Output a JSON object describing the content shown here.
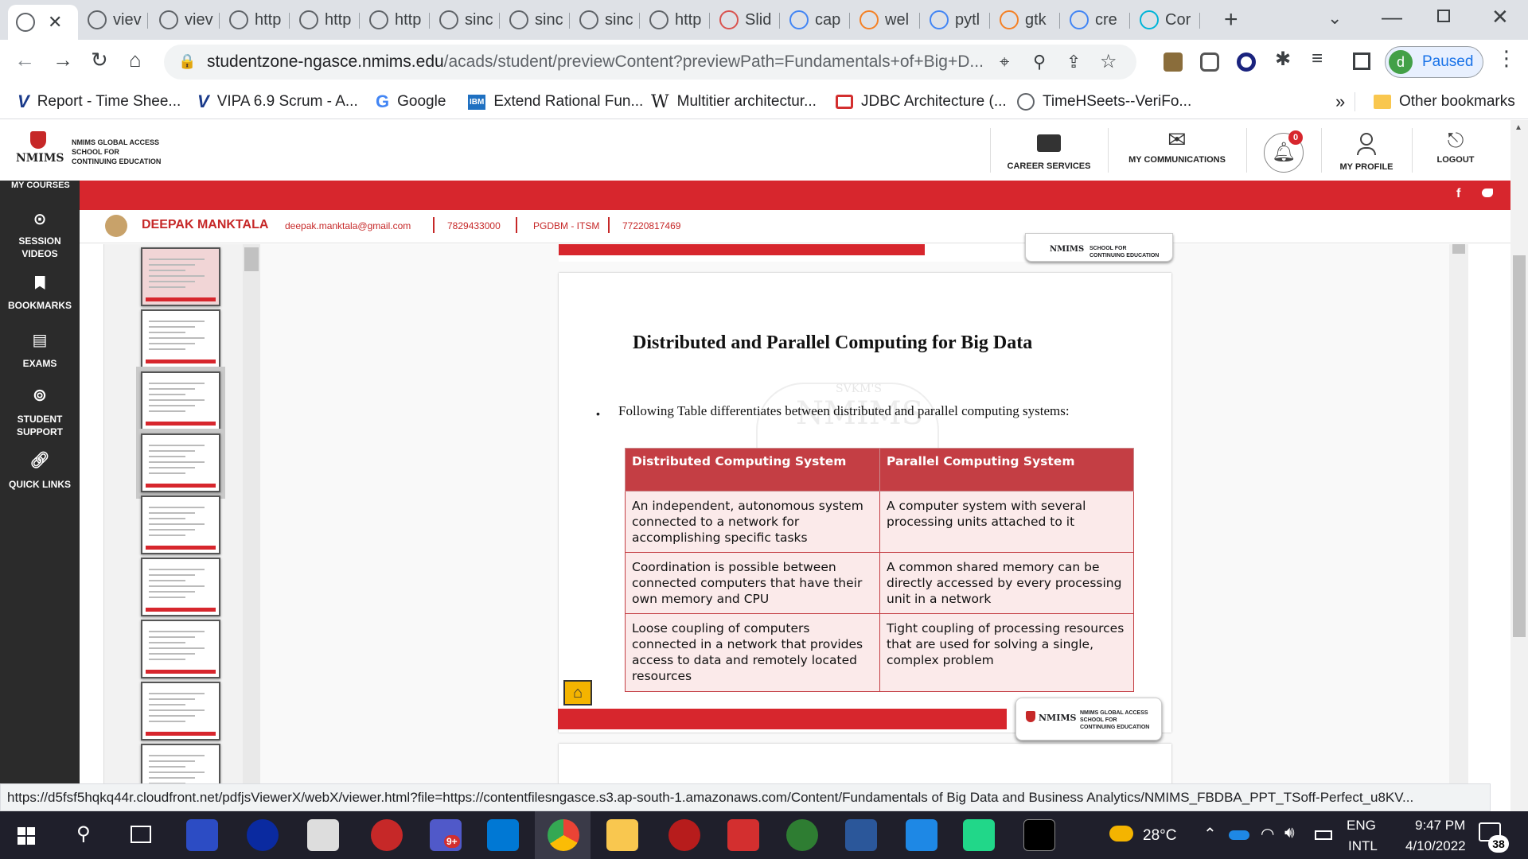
{
  "browser": {
    "tabs": [
      {
        "label": "viev"
      },
      {
        "label": "viev"
      },
      {
        "label": "http"
      },
      {
        "label": "http"
      },
      {
        "label": "http"
      },
      {
        "label": "sinc"
      },
      {
        "label": "sinc"
      },
      {
        "label": "sinc"
      },
      {
        "label": "http"
      },
      {
        "label": "Slid"
      },
      {
        "label": "cap"
      },
      {
        "label": "wel"
      },
      {
        "label": "pytl"
      },
      {
        "label": "gtk"
      },
      {
        "label": "cre"
      },
      {
        "label": "Cor"
      }
    ],
    "url_host": "studentzone-ngasce.nmims.edu",
    "url_path": "/acads/student/previewContent?previewPath=Fundamentals+of+Big+D...",
    "profile_letter": "d",
    "profile_status": "Paused",
    "bookmarks": [
      {
        "label": "Report - Time Shee..."
      },
      {
        "label": "VIPA 6.9 Scrum - A..."
      },
      {
        "label": "Google"
      },
      {
        "label": "Extend Rational Fun..."
      },
      {
        "label": "Multitier architectur..."
      },
      {
        "label": "JDBC Architecture (..."
      },
      {
        "label": "TimeHSeets--VeriFo..."
      }
    ],
    "more_bookmarks": "»",
    "other_bookmarks": "Other bookmarks",
    "status_url": "https://d5fsf5hqkq44r.cloudfront.net/pdfjsViewerX/webX/viewer.html?file=https://contentfilesngasce.s3.ap-south-1.amazonaws.com/Content/Fundamentals of Big Data and Business Analytics/NMIMS_FBDBA_PPT_TSoff-Perfect_u8KV..."
  },
  "site": {
    "logo_text": "NMIMS",
    "logo_sub": "NMIMS GLOBAL ACCESS\nSCHOOL FOR\nCONTINUING EDUCATION",
    "nav": [
      {
        "label": "CAREER SERVICES"
      },
      {
        "label": "MY COMMUNICATIONS"
      },
      {
        "label": "MY PROFILE"
      },
      {
        "label": "LOGOUT"
      }
    ],
    "notification_count": "0",
    "my_courses": "MY COURSES",
    "social": {
      "facebook": "f",
      "twitter": "t"
    },
    "user": {
      "name": "DEEPAK MANKTALA",
      "email": "deepak.manktala@gmail.com",
      "phone": "7829433000",
      "program": "PGDBM - ITSM",
      "student_no": "77220817469"
    },
    "sidebar": [
      {
        "label": "SESSION VIDEOS"
      },
      {
        "label": "BOOKMARKS"
      },
      {
        "label": "EXAMS"
      },
      {
        "label": "STUDENT SUPPORT"
      },
      {
        "label": "QUICK LINKS"
      }
    ]
  },
  "slide": {
    "title": "Distributed and Parallel Computing for Big Data",
    "bullet": "Following Table differentiates between distributed and parallel computing systems:",
    "watermark": "NMIMS",
    "watermark_top": "SVKM'S",
    "footer_logo": "NMIMS",
    "footer_logo_sub": "NMIMS GLOBAL ACCESS\nSCHOOL FOR\nCONTINUING EDUCATION",
    "prev_footer_logo_sub": "SCHOOL FOR\nCONTINUING EDUCATION",
    "table": {
      "headers": [
        "Distributed Computing System",
        "Parallel Computing System"
      ],
      "rows": [
        [
          "An independent, autonomous system connected to a network for accomplishing specific tasks",
          "A computer system with several processing units attached to it"
        ],
        [
          "Coordination is possible between connected computers that have their own memory and CPU",
          "A common shared memory can be directly accessed by every processing unit in a network"
        ],
        [
          "Loose coupling of computers connected in a network that provides access to data and remotely located resources",
          "Tight coupling of processing resources that are used for solving a single, complex problem"
        ]
      ]
    }
  },
  "taskbar": {
    "weather": "28°C",
    "lang_top": "ENG",
    "lang_bottom": "INTL",
    "time": "9:47 PM",
    "date": "4/10/2022",
    "notif_count": "38",
    "teams_badge": "9+"
  },
  "colors": {
    "brand_red": "#d7262d",
    "sidebar_dark": "#2b2b2b",
    "table_header": "#c43e44",
    "table_cell": "#fbeaea"
  }
}
